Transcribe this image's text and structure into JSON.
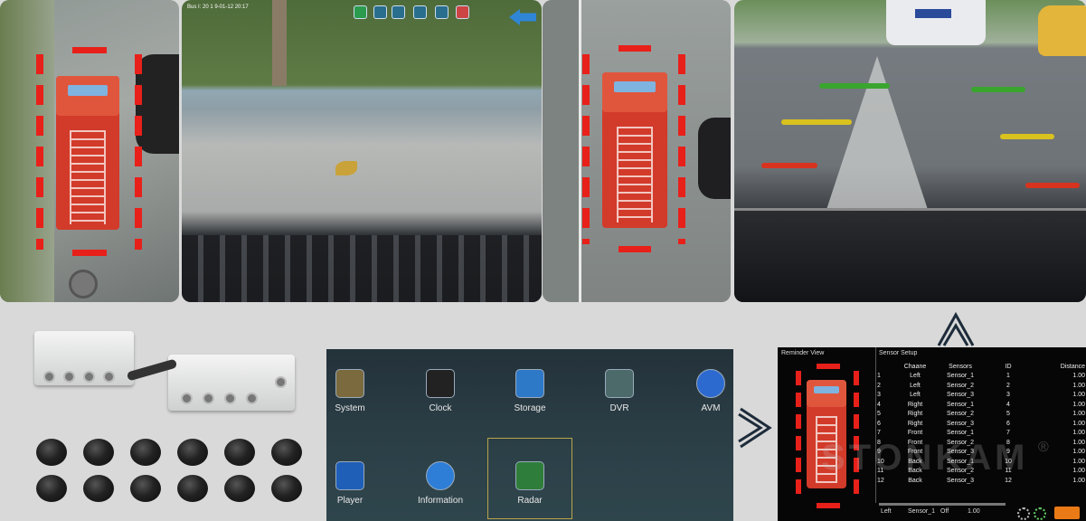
{
  "osd": {
    "timestamp": "Bus I: 20 1 9-01-12 20:17",
    "toolbar_icons": [
      "video-icon",
      "camera-icon",
      "camera-icon",
      "camera-icon",
      "camera-icon",
      "grid-icon",
      "back-arrow-icon"
    ]
  },
  "menu": {
    "items": [
      {
        "label": "System",
        "icon": "system-icon"
      },
      {
        "label": "Clock",
        "icon": "clock-icon"
      },
      {
        "label": "Storage",
        "icon": "storage-icon"
      },
      {
        "label": "DVR",
        "icon": "dvr-icon"
      },
      {
        "label": "AVM",
        "icon": "avm-icon"
      },
      {
        "label": "Player",
        "icon": "player-icon"
      },
      {
        "label": "Information",
        "icon": "information-icon"
      },
      {
        "label": "Radar",
        "icon": "radar-icon"
      }
    ],
    "selected": "Radar"
  },
  "screen": {
    "left_title": "Reminder View",
    "right_title": "Sensor Setup",
    "headers": [
      "",
      "Chaane",
      "Sensors",
      "ID",
      "Distance"
    ],
    "rows": [
      [
        "1",
        "Left",
        "Sensor_1",
        "1",
        "1.00"
      ],
      [
        "2",
        "Left",
        "Sensor_2",
        "2",
        "1.00"
      ],
      [
        "3",
        "Left",
        "Sensor_3",
        "3",
        "1.00"
      ],
      [
        "4",
        "Right",
        "Sensor_1",
        "4",
        "1.00"
      ],
      [
        "5",
        "Right",
        "Sensor_2",
        "5",
        "1.00"
      ],
      [
        "6",
        "Right",
        "Sensor_3",
        "6",
        "1.00"
      ],
      [
        "7",
        "Front",
        "Sensor_1",
        "7",
        "1.00"
      ],
      [
        "8",
        "Front",
        "Sensor_2",
        "8",
        "1.00"
      ],
      [
        "9",
        "Front",
        "Sensor_3",
        "9",
        "1.00"
      ],
      [
        "10",
        "Back",
        "Sensor_1",
        "10",
        "1.00"
      ],
      [
        "11",
        "Back",
        "Sensor_2",
        "11",
        "1.00"
      ],
      [
        "12",
        "Back",
        "Sensor_3",
        "12",
        "1.00"
      ]
    ],
    "status": {
      "channel": "Left",
      "sensor": "Sensor_1",
      "state": "Off",
      "value": "1.00"
    },
    "watermark": "STONKAM",
    "registered": "®"
  },
  "colors": {
    "alert": "#e8201a",
    "guide_green": "#3aa52e",
    "guide_yellow": "#d9c21e",
    "guide_red": "#d8331f"
  }
}
